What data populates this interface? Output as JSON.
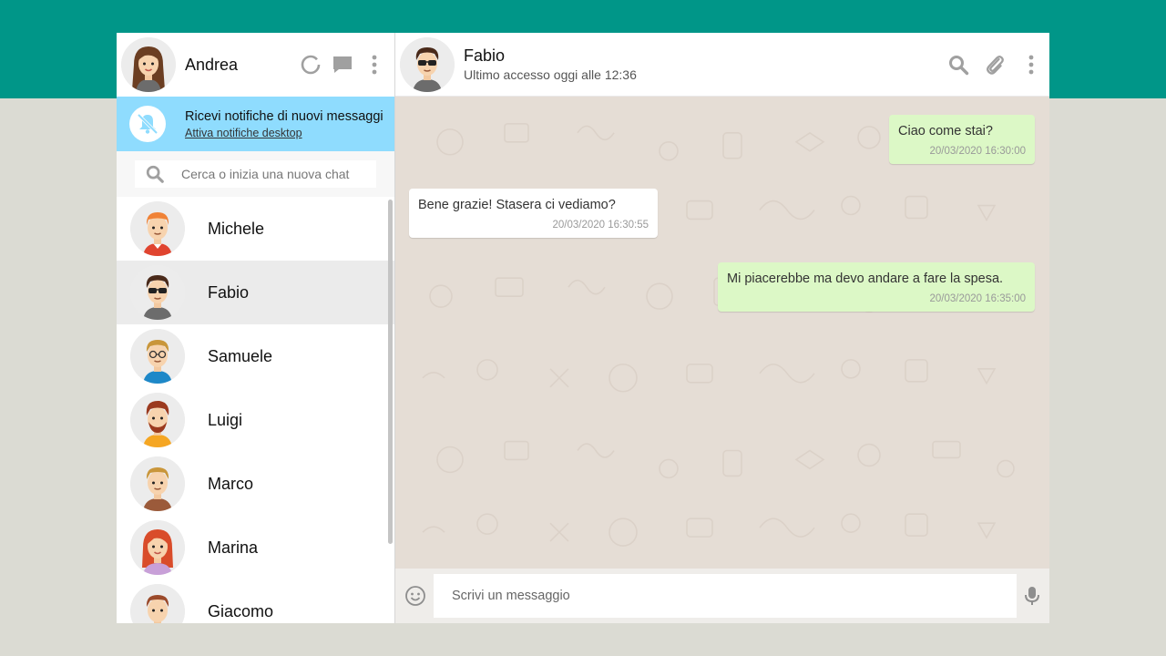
{
  "me": {
    "name": "Andrea",
    "avatar_icon": "avatar-andrea-icon"
  },
  "header_icons": [
    "status-circle-icon",
    "chat-bubble-icon",
    "kebab-menu-icon"
  ],
  "notification": {
    "title": "Ricevi notifiche di nuovi messaggi",
    "link": "Attiva notifiche desktop",
    "icon": "bell-off-icon",
    "bg_color": "#8fdcfe"
  },
  "search": {
    "placeholder": "Cerca o inizia una nuova chat"
  },
  "contacts": [
    {
      "name": "Michele",
      "active": false
    },
    {
      "name": "Fabio",
      "active": true
    },
    {
      "name": "Samuele",
      "active": false
    },
    {
      "name": "Luigi",
      "active": false
    },
    {
      "name": "Marco",
      "active": false
    },
    {
      "name": "Marina",
      "active": false
    },
    {
      "name": "Giacomo",
      "active": false
    }
  ],
  "chat": {
    "name": "Fabio",
    "status": "Ultimo accesso oggi alle 12:36",
    "icons": [
      "search-icon",
      "paperclip-icon",
      "kebab-menu-icon"
    ],
    "messages": [
      {
        "direction": "out",
        "text": "Ciao come stai?",
        "time": "20/03/2020 16:30:00"
      },
      {
        "direction": "in",
        "text": "Bene grazie! Stasera ci vediamo?",
        "time": "20/03/2020 16:30:55"
      },
      {
        "direction": "out",
        "text": "Mi piacerebbe ma devo andare a fare la spesa.",
        "time": "20/03/2020 16:35:00"
      }
    ]
  },
  "composer": {
    "placeholder": "Scrivi un messaggio",
    "left_icon": "emoji-icon",
    "right_icon": "microphone-icon"
  },
  "colors": {
    "top_band": "#009688",
    "page_bg": "#dbdbd3",
    "chat_bg": "#e5ddd5",
    "bubble_out": "#dcf8c6",
    "bubble_in": "#ffffff",
    "active_contact": "#ebebeb",
    "icon_gray": "#a0a0a0"
  }
}
